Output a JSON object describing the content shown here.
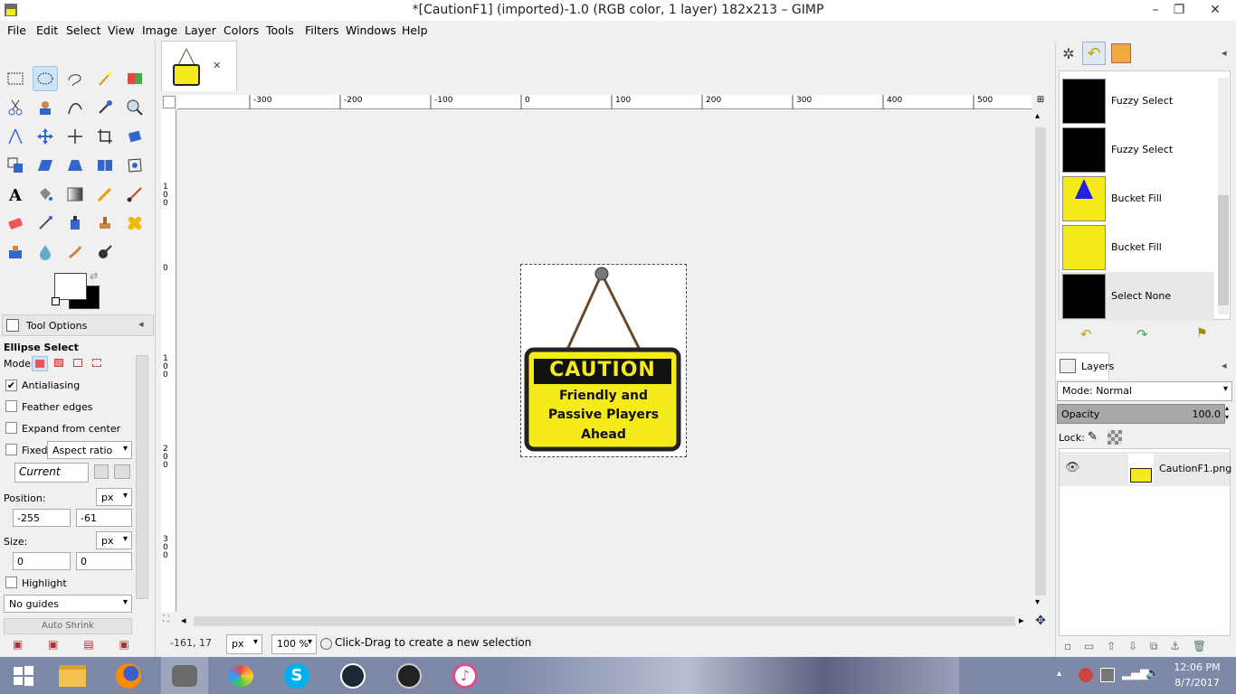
{
  "window": {
    "title": "*[CautionF1] (imported)-1.0 (RGB color, 1 layer) 182x213 – GIMP",
    "min_glyph": "–",
    "max_glyph": "❐",
    "close_glyph": "✕"
  },
  "menu": [
    "File",
    "Edit",
    "Select",
    "View",
    "Image",
    "Layer",
    "Colors",
    "Tools",
    "Filters",
    "Windows",
    "Help"
  ],
  "image_tab": {
    "close_glyph": "✕"
  },
  "tool_options": {
    "header": "Tool Options",
    "tool_name": "Ellipse Select",
    "mode_label": "Mode:",
    "antialiasing_label": "Antialiasing",
    "antialiasing_checked": true,
    "feather_label": "Feather edges",
    "expand_label": "Expand from center",
    "fixed_label": "Fixed:",
    "fixed_value": "Aspect ratio",
    "current_value": "Current",
    "position_label": "Position:",
    "position_unit": "px",
    "position_x": "-255",
    "position_y": "-61",
    "size_label": "Size:",
    "size_unit": "px",
    "size_w": "0",
    "size_h": "0",
    "highlight_label": "Highlight",
    "guides_value": "No guides",
    "auto_shrink_label": "Auto Shrink"
  },
  "ruler": {
    "h_ticks": [
      "-300",
      "-200",
      "-100",
      "0",
      "100",
      "200",
      "300",
      "400",
      "500"
    ],
    "v_ticks": [
      "100",
      "0",
      "100",
      "200",
      "300"
    ]
  },
  "image": {
    "sign_title": "CAUTION",
    "sign_line1": "Friendly and",
    "sign_line2": "Passive Players",
    "sign_line3": "Ahead",
    "sign_color": "#f5ea1a"
  },
  "status": {
    "coords": "-161, 17",
    "unit": "px",
    "zoom": "100 %",
    "message": "Click-Drag to create a new selection"
  },
  "undo_history": [
    {
      "label": "Fuzzy Select"
    },
    {
      "label": "Fuzzy Select"
    },
    {
      "label": "Bucket Fill"
    },
    {
      "label": "Bucket Fill"
    },
    {
      "label": "Select None"
    }
  ],
  "layers": {
    "tab_label": "Layers",
    "mode_label": "Mode:",
    "mode_value": "Normal",
    "opacity_label": "Opacity",
    "opacity_value": "100.0",
    "lock_label": "Lock:",
    "items": [
      {
        "name": "CautionF1.png",
        "visible": true
      }
    ]
  },
  "taskbar": {
    "time": "12:06 PM",
    "date": "8/7/2017"
  }
}
